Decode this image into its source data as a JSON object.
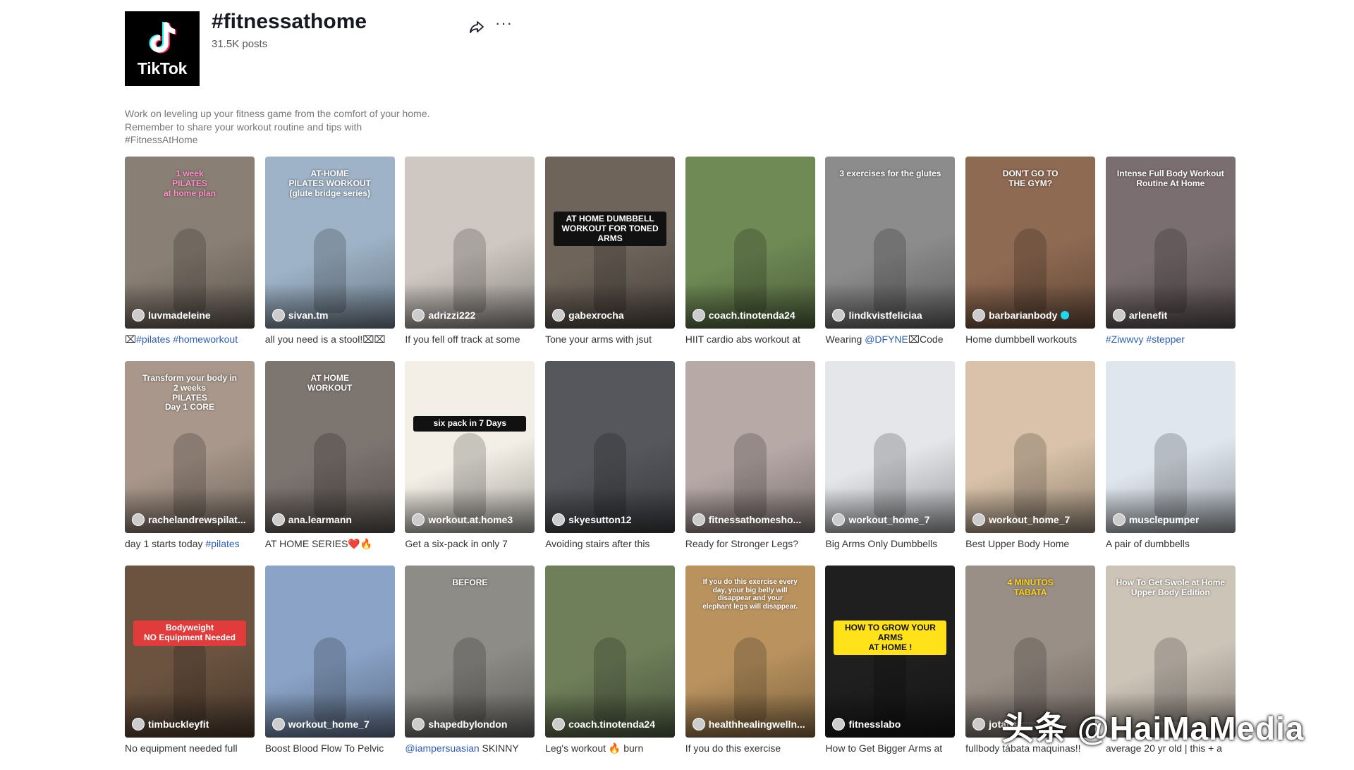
{
  "hashtag": {
    "title": "#fitnessathome",
    "post_count": "31.5K posts",
    "description_lines": [
      "Work on leveling up your fitness game from the comfort of your home.",
      "Remember to share your workout routine and tips with",
      "#FitnessAtHome"
    ]
  },
  "logo": {
    "text": "TikTok"
  },
  "actions": {
    "share_icon": "share-arrow-icon",
    "more_label": "···"
  },
  "watermark": "头条 @HaiMaMedia",
  "videos": [
    {
      "author": "luvmadeleine",
      "caption_pre": "⌧",
      "caption_tag": "#pilates #homeworkout",
      "caption_post": "",
      "bg": "#8a7f74",
      "overlay": "1 week\nPILATES\nat home plan",
      "ov_color": "#ff8fc7",
      "ov_bg": ""
    },
    {
      "author": "sivan.tm",
      "caption_pre": "all you need is a stool!⌧⌧",
      "caption_tag": "",
      "caption_post": "",
      "bg": "#9eb3c7",
      "overlay": "AT-HOME\nPILATES WORKOUT\n(glute bridge series)",
      "ov_color": "#ffffff",
      "ov_bg": ""
    },
    {
      "author": "adrizzi222",
      "caption_pre": "If you fell off track at some",
      "caption_tag": "",
      "caption_post": "",
      "bg": "#cfc8c2",
      "overlay": "",
      "ov_color": "#333",
      "ov_bg": ""
    },
    {
      "author": "gabexrocha",
      "caption_pre": "Tone your arms with jsut",
      "caption_tag": "",
      "caption_post": "",
      "bg": "#6e645a",
      "overlay": "AT HOME DUMBBELL\nWORKOUT FOR TONED\nARMS",
      "ov_color": "#ffffff",
      "ov_bg": "#111"
    },
    {
      "author": "coach.tinotenda24",
      "caption_pre": "HIIT cardio abs workout at",
      "caption_tag": "",
      "caption_post": "",
      "bg": "#6f8a55",
      "overlay": "",
      "ov_color": "#fff",
      "ov_bg": ""
    },
    {
      "author": "lindkvistfeliciaa",
      "caption_pre": "Wearing ",
      "caption_tag": "@DFYNE",
      "caption_post": "⌧Code",
      "bg": "#8c8c8c",
      "overlay": "3 exercises for the glutes",
      "ov_color": "#ffffff",
      "ov_bg": ""
    },
    {
      "author": "barbarianbody",
      "verified": true,
      "caption_pre": "Home dumbbell workouts",
      "caption_tag": "",
      "caption_post": "",
      "bg": "#8f6a52",
      "overlay": "DON'T GO TO\nTHE GYM?",
      "ov_color": "#ffffff",
      "ov_bg": ""
    },
    {
      "author": "arlenefit",
      "caption_pre": "",
      "caption_tag": "#Ziwwvy #stepper",
      "caption_post": "",
      "bg": "#7a6e70",
      "overlay": "Intense Full Body Workout\nRoutine At Home",
      "ov_color": "#ffffff",
      "ov_bg": ""
    },
    {
      "author": "rachelandrewspilat...",
      "caption_pre": "day 1 starts today ",
      "caption_tag": "#pilates",
      "caption_post": "",
      "bg": "#a8978a",
      "overlay": "Transform your body in\n2 weeks\nPILATES\nDay 1 CORE",
      "ov_color": "#ffffff",
      "ov_bg": ""
    },
    {
      "author": "ana.learmann",
      "caption_pre": "AT HOME SERIES❤️🔥",
      "caption_tag": "",
      "caption_post": "",
      "bg": "#7d7570",
      "overlay": "AT HOME\nWORKOUT",
      "ov_color": "#ffffff",
      "ov_bg": ""
    },
    {
      "author": "workout.at.home3",
      "caption_pre": "Get a six-pack in only 7",
      "caption_tag": "",
      "caption_post": "",
      "bg": "#f3efe6",
      "overlay": "six pack in 7 Days",
      "ov_color": "#ffffff",
      "ov_bg": "#111"
    },
    {
      "author": "skyesutton12",
      "caption_pre": "Avoiding stairs after this",
      "caption_tag": "",
      "caption_post": "",
      "bg": "#55575c",
      "overlay": "",
      "ov_color": "#fff",
      "ov_bg": ""
    },
    {
      "author": "fitnessathomesho...",
      "caption_pre": "Ready for Stronger Legs?",
      "caption_tag": "",
      "caption_post": "",
      "bg": "#b7a9a6",
      "overlay": "",
      "ov_color": "#fff",
      "ov_bg": ""
    },
    {
      "author": "workout_home_7",
      "caption_pre": "Big Arms Only Dumbbells",
      "caption_tag": "",
      "caption_post": "",
      "bg": "#e4e6ea",
      "overlay": "",
      "ov_color": "#fff",
      "ov_bg": ""
    },
    {
      "author": "workout_home_7",
      "caption_pre": "Best Upper Body Home",
      "caption_tag": "",
      "caption_post": "",
      "bg": "#d9c2a9",
      "overlay": "",
      "ov_color": "#fff",
      "ov_bg": ""
    },
    {
      "author": "musclepumper",
      "caption_pre": "A pair of dumbbells",
      "caption_tag": "",
      "caption_post": "",
      "bg": "#dfe6ee",
      "overlay": "",
      "ov_color": "#fff",
      "ov_bg": ""
    },
    {
      "author": "timbuckleyfit",
      "caption_pre": "No equipment needed full",
      "caption_tag": "",
      "caption_post": "",
      "bg": "#6b5340",
      "overlay": "Bodyweight\nNO Equipment Needed",
      "ov_color": "#ffffff",
      "ov_bg": "#e23b3b"
    },
    {
      "author": "workout_home_7",
      "caption_pre": "Boost Blood Flow To Pelvic",
      "caption_tag": "",
      "caption_post": "",
      "bg": "#8aa3c7",
      "overlay": "",
      "ov_color": "#fff",
      "ov_bg": ""
    },
    {
      "author": "shapedbylondon",
      "caption_pre": "",
      "caption_tag": "@iampersuasian",
      "caption_post": " SKINNY",
      "bg": "#8d8c87",
      "overlay": "BEFORE",
      "ov_color": "#ffffff",
      "ov_bg": ""
    },
    {
      "author": "coach.tinotenda24",
      "caption_pre": "Leg's workout 🔥 burn",
      "caption_tag": "",
      "caption_post": "",
      "bg": "#6e7f5a",
      "overlay": "",
      "ov_color": "#fff",
      "ov_bg": ""
    },
    {
      "author": "healthhealingwelln...",
      "caption_pre": "If you do this exercise",
      "caption_tag": "",
      "caption_post": "",
      "bg": "#b9925e",
      "overlay": "If you do this exercise every\nday, your big belly will\ndisappear and your\nelephant legs will disappear.",
      "ov_color": "#ffffff",
      "ov_bg": ""
    },
    {
      "author": "fitnesslabo",
      "caption_pre": "How to Get Bigger Arms at",
      "caption_tag": "",
      "caption_post": "",
      "bg": "#1f1f1f",
      "overlay": "HOW TO GROW YOUR ARMS\nAT HOME !",
      "ov_color": "#111111",
      "ov_bg": "#ffe21a"
    },
    {
      "author": "jotaliss...",
      "caption_pre": "fullbody tábata maquinas!!",
      "caption_tag": "",
      "caption_post": "",
      "bg": "#9a8f86",
      "overlay": "4 MINUTOS\nTABATA",
      "ov_color": "#ffd21a",
      "ov_bg": ""
    },
    {
      "author": "",
      "caption_pre": "average 20 yr old | this + a",
      "caption_tag": "",
      "caption_post": "",
      "bg": "#cdc4b8",
      "overlay": "How To Get Swole at Home\nUpper Body Edition",
      "ov_color": "#ffffff",
      "ov_bg": ""
    }
  ]
}
